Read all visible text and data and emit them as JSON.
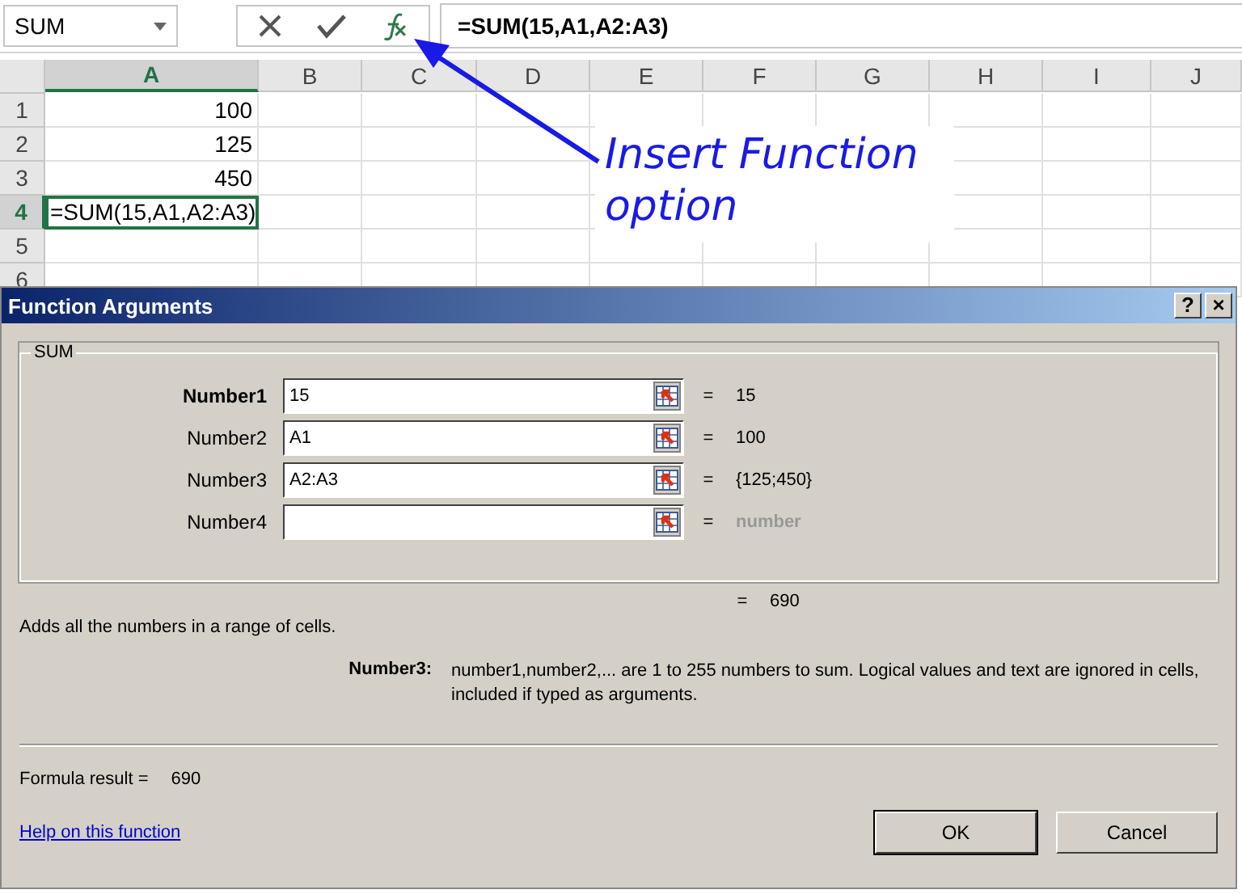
{
  "name_box": {
    "value": "SUM"
  },
  "formula_bar": {
    "value": "=SUM(15,A1,A2:A3)"
  },
  "columns": [
    {
      "label": "A",
      "selected": true
    },
    {
      "label": "B",
      "selected": false
    },
    {
      "label": "C",
      "selected": false
    },
    {
      "label": "D",
      "selected": false
    },
    {
      "label": "E",
      "selected": false
    },
    {
      "label": "F",
      "selected": false
    },
    {
      "label": "G",
      "selected": false
    },
    {
      "label": "H",
      "selected": false
    },
    {
      "label": "I",
      "selected": false
    },
    {
      "label": "J",
      "selected": false
    }
  ],
  "rows": [
    {
      "label": "1",
      "selected": false,
      "cells": [
        "100"
      ]
    },
    {
      "label": "2",
      "selected": false,
      "cells": [
        "125"
      ]
    },
    {
      "label": "3",
      "selected": false,
      "cells": [
        "450"
      ]
    },
    {
      "label": "4",
      "selected": true,
      "cells": [
        "=SUM(15,A1,A2:A3)"
      ]
    },
    {
      "label": "5",
      "selected": false,
      "cells": []
    },
    {
      "label": "6",
      "selected": false,
      "cells": []
    }
  ],
  "annotation": {
    "lines": [
      "Insert Function",
      "option"
    ]
  },
  "dialog": {
    "title": "Function Arguments",
    "help_button": "?",
    "close_button": "×",
    "group": "SUM",
    "arguments": [
      {
        "label": "Number1",
        "value": "15",
        "result": "15",
        "selected": true,
        "placeholder_result": false
      },
      {
        "label": "Number2",
        "value": "A1",
        "result": "100",
        "selected": false,
        "placeholder_result": false
      },
      {
        "label": "Number3",
        "value": "A2:A3",
        "result": "{125;450}",
        "selected": false,
        "placeholder_result": false
      },
      {
        "label": "Number4",
        "result": "number",
        "selected": false,
        "placeholder_result": true
      }
    ],
    "equals": "=",
    "total": "690",
    "description": "Adds all the numbers in a range of cells.",
    "arg_help_label": "Number3:",
    "arg_help_text": "number1,number2,... are 1 to 255 numbers to sum. Logical values and text are ignored in cells, included if typed as arguments.",
    "formula_result_label": "Formula result =",
    "formula_result": "690",
    "help_link": "Help on this function",
    "buttons": [
      "OK",
      "Cancel"
    ]
  }
}
